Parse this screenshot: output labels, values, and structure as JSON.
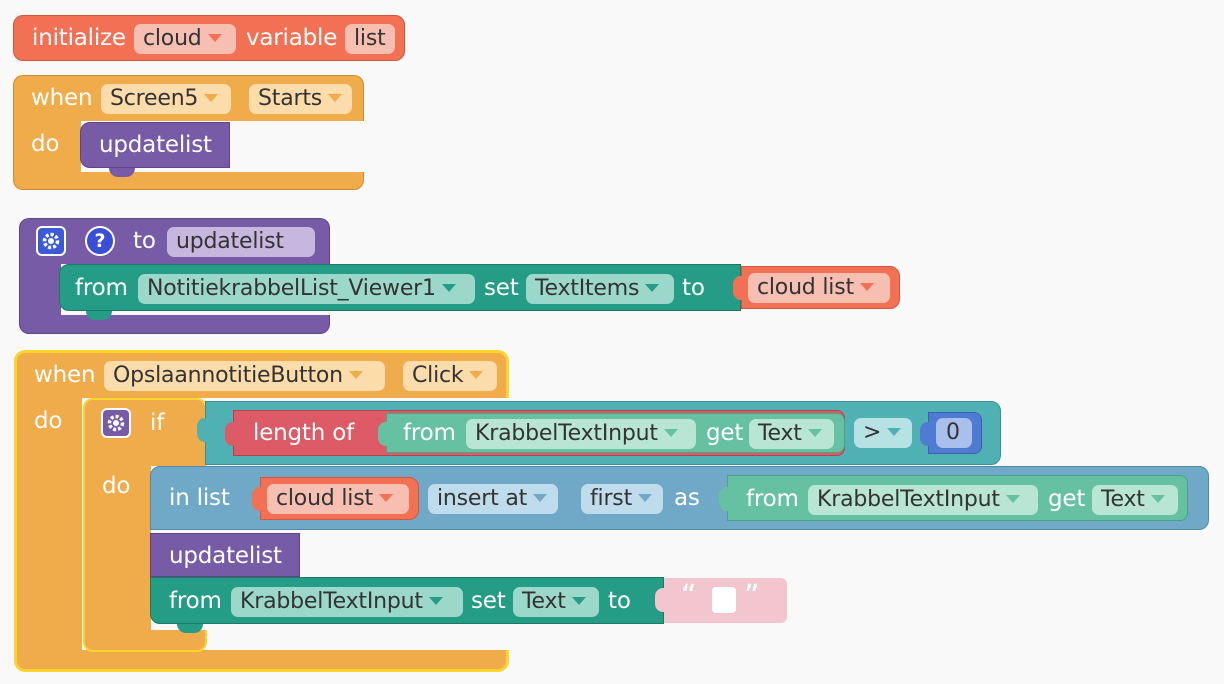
{
  "global_var": {
    "initialize": "initialize",
    "name": "cloud",
    "variable": "variable",
    "value": "list"
  },
  "screen_start": {
    "when": "when",
    "component": "Screen5",
    "event": "Starts",
    "do": "do",
    "call": "updatelist"
  },
  "procedure": {
    "to": "to",
    "name": "updatelist",
    "from": "from",
    "component": "NotitiekrabbelList_Viewer1",
    "set": "set",
    "property": "TextItems",
    "to_kw": "to",
    "value": "cloud list"
  },
  "click_event": {
    "when": "when",
    "component": "OpslaannotitieButton",
    "event": "Click",
    "do": "do",
    "if_kw": "if",
    "length_of": "length of",
    "from": "from",
    "input_component": "KrabbelTextInput",
    "get": "get",
    "property": "Text",
    "operator": ">",
    "number": "0",
    "do_inner": "do",
    "in_list": "in list",
    "list_var": "cloud list",
    "insert_at": "insert at",
    "position": "first",
    "as": "as",
    "from2": "from",
    "input_component2": "KrabbelTextInput",
    "get2": "get",
    "property2": "Text",
    "call": "updatelist",
    "from3": "from",
    "input_component3": "KrabbelTextInput",
    "set": "set",
    "property3": "Text",
    "to_kw": "to",
    "empty_open": "“",
    "empty_close": "”"
  },
  "colors": {
    "variables": "#f27155",
    "events": "#f0ab4a",
    "procedures": "#785ba6",
    "components": "#249c86",
    "control": "#4fb1b4",
    "text": "#dd5a67",
    "lists": "#70a9c8",
    "math": "#4f7cd2",
    "selected_outline": "#fcd430"
  }
}
